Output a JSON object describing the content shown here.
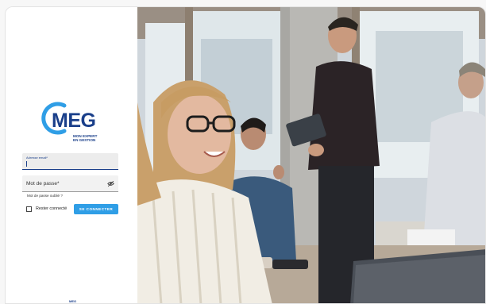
{
  "brand": {
    "logo_text": "MEG",
    "tagline_line1": "MON EXPERT",
    "tagline_line2": "EN GESTION",
    "color": "#1a3f8a"
  },
  "login": {
    "email_label": "Adresse email*",
    "password_label": "Mot de passe*",
    "forgot_password": "Mot de passe oublié ?",
    "remember_me": "Rester connecté",
    "submit_label": "SE CONNECTER",
    "accent_color": "#2f9ee6"
  },
  "footer": {
    "mark": "MEG"
  },
  "icons": {
    "password_toggle": "eye-off-icon"
  }
}
